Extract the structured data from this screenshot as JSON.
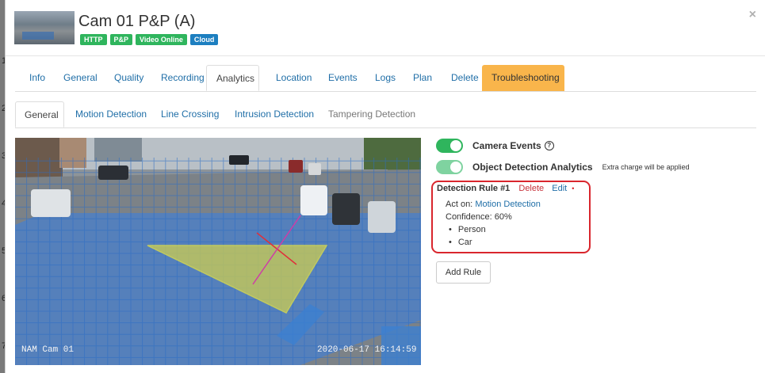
{
  "backdrop_row_numbers": [
    "1",
    "2",
    "3",
    "4",
    "5",
    "6",
    "7"
  ],
  "header": {
    "title": "Cam 01 P&P (A)",
    "badges": [
      {
        "label": "HTTP",
        "color": "#2fb55d"
      },
      {
        "label": "P&P",
        "color": "#2fb55d"
      },
      {
        "label": "Video Online",
        "color": "#2fb55d"
      },
      {
        "label": "Cloud",
        "color": "#1d7fc0"
      }
    ],
    "close_label": "×"
  },
  "main_tabs": [
    "Info",
    "General",
    "Quality",
    "Recording",
    "Analytics",
    "Location",
    "Events",
    "Logs",
    "Plan",
    "Delete",
    "Troubleshooting"
  ],
  "main_tabs_active": "Analytics",
  "sub_tabs": [
    "General",
    "Motion Detection",
    "Line Crossing",
    "Intrusion Detection",
    "Tampering Detection"
  ],
  "sub_tabs_active": "General",
  "camera": {
    "overlay_name": "NAM Cam 01",
    "overlay_timestamp": "2020-06-17 16:14:59"
  },
  "settings": {
    "camera_events_label": "Camera Events",
    "camera_events_help": "?",
    "camera_events_on": true,
    "object_detection_label": "Object Detection Analytics",
    "object_detection_note": "Extra charge will be applied",
    "object_detection_on": true
  },
  "rule": {
    "title": "Detection Rule #1",
    "delete_label": "Delete",
    "edit_label": "Edit",
    "dot": "•",
    "act_on_label": "Act on:",
    "act_on_value": "Motion Detection",
    "confidence": "Confidence: 60%",
    "objects": [
      "Person",
      "Car"
    ]
  },
  "add_rule_label": "Add Rule",
  "colors": {
    "accent": "#1f6ea7",
    "success": "#2fb55d",
    "warning": "#f9b54b",
    "danger": "#d9262d",
    "info": "#1d7fc0"
  }
}
